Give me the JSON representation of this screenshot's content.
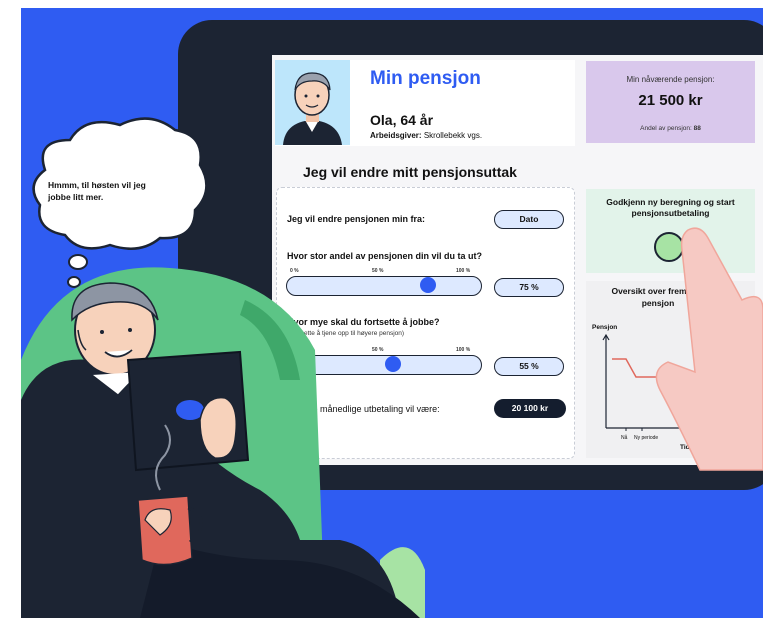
{
  "bubble": {
    "text": "Hmmm, til høsten vil jeg jobbe litt mer."
  },
  "profile": {
    "title": "Min pensjon",
    "name": "Ola, 64 år",
    "employer_label": "Arbeidsgiver:",
    "employer_value": "Skrollebekk vgs."
  },
  "current_pension": {
    "label": "Min nåværende pensjon:",
    "value": "21 500 kr",
    "share_label": "Andel av pensjon:",
    "share_value": "88"
  },
  "form": {
    "section_title": "Jeg vil endre mitt pensjonsuttak",
    "change_from_label": "Jeg vil endre pensjonen min fra:",
    "date_button": "Dato",
    "share_question": "Hvor stor andel av pensjonen din vil du ta ut?",
    "share_ticks": [
      "0 %",
      "50 %",
      "100 %"
    ],
    "share_fraction": 0.75,
    "share_value": "75 %",
    "work_question": "Hvor mye skal du fortsette å jobbe?",
    "work_note": "(Fortsette å tjene opp til høyere pensjon)",
    "work_ticks": [
      "0 %",
      "50 %",
      "100 %"
    ],
    "work_fraction": 0.55,
    "work_value": "55 %",
    "monthly_label": "Din nye månedlige utbetaling vil være:",
    "monthly_value": "20 100 kr"
  },
  "approve": {
    "text": "Godkjenn ny beregning og start pensjonsutbetaling"
  },
  "overview": {
    "title": "Oversikt over fremtidig pensjon",
    "ylabel": "Pensjon",
    "xlabel": "Tid",
    "x_ticks": [
      "Nå",
      "Ny periode"
    ]
  },
  "colors": {
    "background": "#2f5cf2",
    "accent": "#2f5cf2",
    "pension_box": "#d9c8ec",
    "approve_box": "#e2f3ea",
    "chart_line": "#e0685c",
    "chair": "#5cc486"
  }
}
